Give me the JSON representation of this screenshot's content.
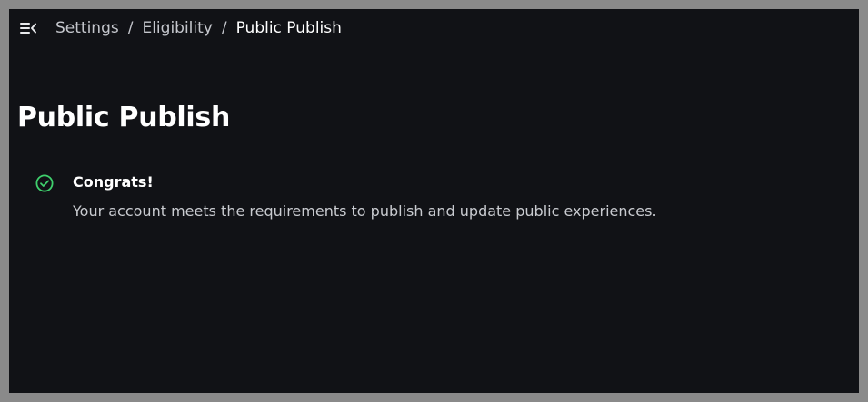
{
  "breadcrumb": {
    "items": [
      "Settings",
      "Eligibility"
    ],
    "separator": "/",
    "current": "Public Publish"
  },
  "page": {
    "title": "Public Publish"
  },
  "status": {
    "icon": "check-circle-icon",
    "title": "Congrats!",
    "message": "Your account meets the requirements to publish and update public experiences.",
    "color": "#3fd06d"
  },
  "theme": {
    "background": "#111216",
    "frame": "#8a8a8a"
  }
}
